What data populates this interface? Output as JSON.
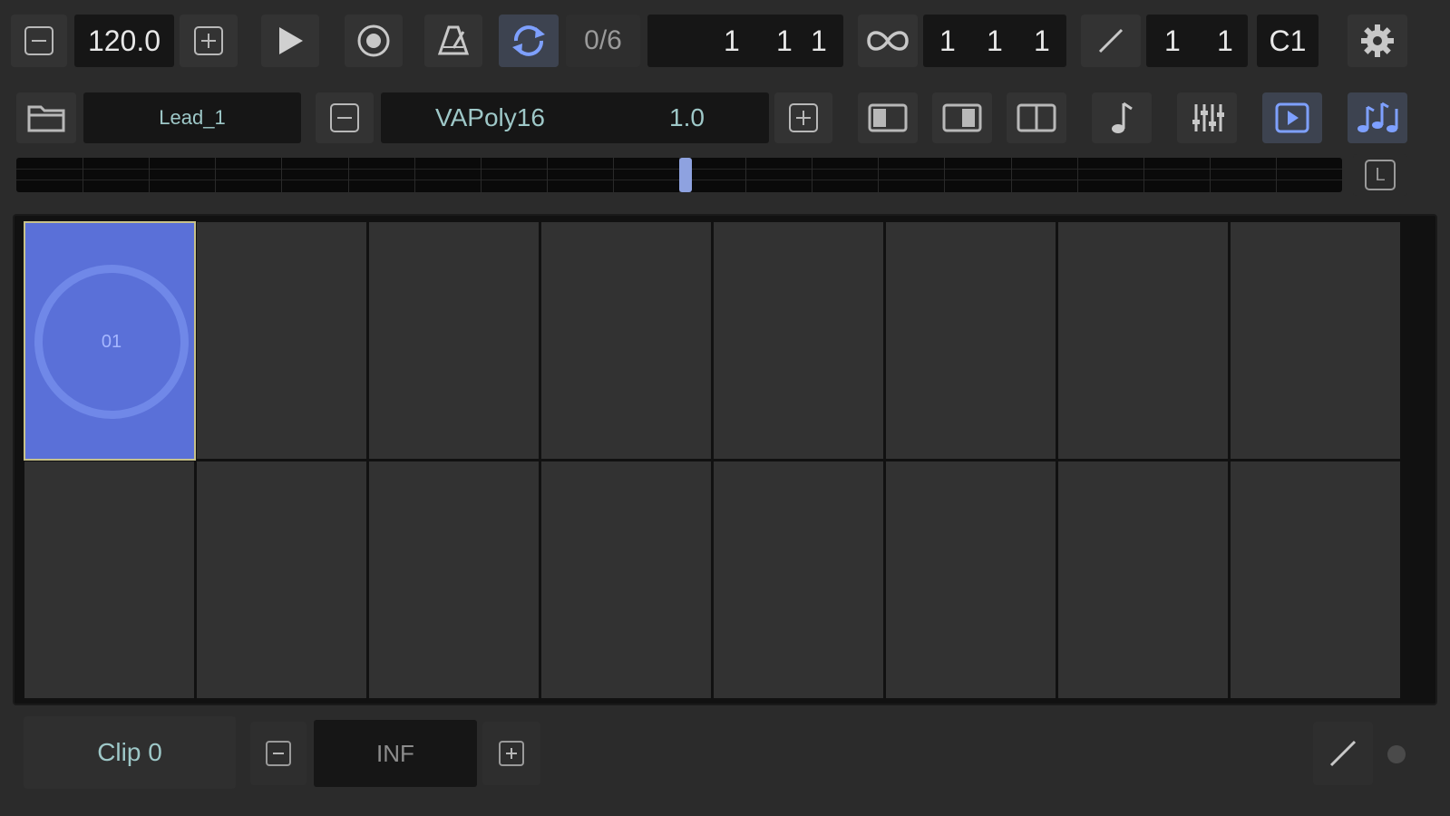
{
  "colors": {
    "background": "#2b2b2b",
    "field": "#161616",
    "button": "#333333",
    "accent_blue": "#5a70d8",
    "icon_blue": "#7ea0ff",
    "text_teal": "#9ec8c8",
    "selection_border": "#c7c18a"
  },
  "transport": {
    "tempo": "120.0",
    "step_count": "0/6",
    "position": {
      "bar": "1",
      "beat": "1",
      "tick": "1"
    },
    "loop_length": {
      "bar": "1",
      "beat": "1",
      "tick": "1"
    },
    "quantize": {
      "a": "1",
      "b": "1"
    },
    "root_note": "C1"
  },
  "track": {
    "name": "Lead_1",
    "instrument": "VAPoly16",
    "instrument_value": "1.0"
  },
  "ruler": {
    "lock_label": "L",
    "playhead_fraction": 0.5
  },
  "clip_grid": {
    "rows": 2,
    "cols": 8,
    "selected_cell_label": "01"
  },
  "bottom_bar": {
    "clip_name": "Clip 0",
    "repeat_value": "INF"
  },
  "icons": [
    "minus-icon",
    "plus-icon",
    "play-icon",
    "record-icon",
    "metronome-icon",
    "loop-sync-icon",
    "infinity-icon",
    "pencil-icon",
    "gear-icon",
    "folder-icon",
    "panel-left-icon",
    "panel-center-icon",
    "panel-split-icon",
    "note-icon",
    "mixer-icon",
    "play-view-icon",
    "notes-icon",
    "lock-icon"
  ]
}
